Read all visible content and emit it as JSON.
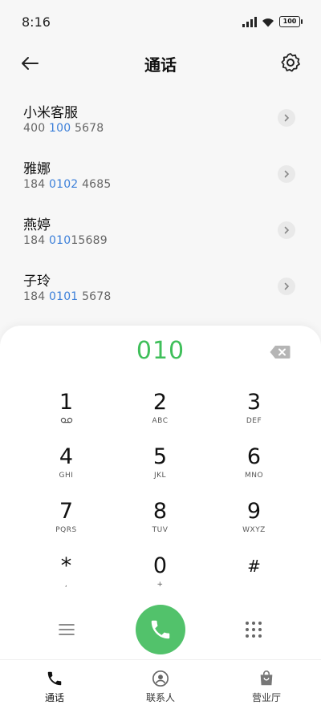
{
  "status_bar": {
    "time": "8:16",
    "battery": "100"
  },
  "header": {
    "title": "通话"
  },
  "contacts": [
    {
      "name": "小米客服",
      "number_parts": [
        "400",
        " 100",
        " 5678"
      ]
    },
    {
      "name": "雅娜",
      "number_parts": [
        "184 ",
        "0102",
        " 4685"
      ]
    },
    {
      "name": "燕婷",
      "number_parts": [
        "184 ",
        "010",
        "15689"
      ]
    },
    {
      "name": "子玲",
      "number_parts": [
        "184 ",
        "0101",
        " 5678"
      ]
    }
  ],
  "dialer": {
    "input": "010",
    "keys": [
      {
        "digit": "1",
        "letters": "voicemail"
      },
      {
        "digit": "2",
        "letters": "ABC"
      },
      {
        "digit": "3",
        "letters": "DEF"
      },
      {
        "digit": "4",
        "letters": "GHI"
      },
      {
        "digit": "5",
        "letters": "JKL"
      },
      {
        "digit": "6",
        "letters": "MNO"
      },
      {
        "digit": "7",
        "letters": "PQRS"
      },
      {
        "digit": "8",
        "letters": "TUV"
      },
      {
        "digit": "9",
        "letters": "WXYZ"
      },
      {
        "digit": "*",
        "letters": ","
      },
      {
        "digit": "0",
        "letters": "+"
      },
      {
        "digit": "#",
        "letters": ""
      }
    ]
  },
  "tabs": [
    {
      "label": "通话",
      "icon": "phone-icon"
    },
    {
      "label": "联系人",
      "icon": "contact-icon"
    },
    {
      "label": "营业厅",
      "icon": "bag-icon"
    }
  ],
  "colors": {
    "accent_green": "#52c26b",
    "highlight_blue": "#3b7fd9",
    "dial_text": "#3fbf5a"
  }
}
